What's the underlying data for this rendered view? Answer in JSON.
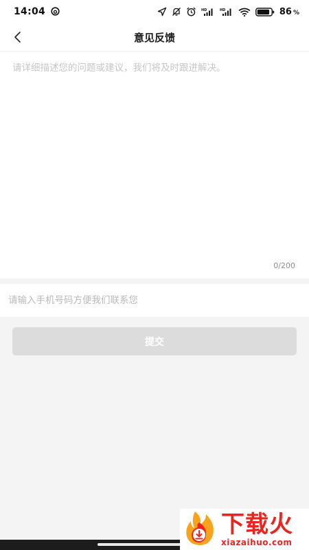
{
  "status_bar": {
    "time": "14:04",
    "battery_percent": "86",
    "percent_sign": "%",
    "icons": [
      "netease-cloud-icon",
      "location-arrow-icon",
      "mute-bell-icon",
      "alarm-icon",
      "signal-hd-1-icon",
      "signal-hd-2-icon",
      "wifi-icon",
      "battery-icon"
    ]
  },
  "nav": {
    "title": "意见反馈",
    "back_icon": "chevron-left-icon"
  },
  "feedback": {
    "placeholder": "请详细描述您的问题或建议，我们将及时跟进解决。",
    "value": "",
    "char_count": "0/200"
  },
  "phone": {
    "placeholder": "请输入手机号码方便我们联系您",
    "value": ""
  },
  "submit": {
    "label": "提交"
  },
  "watermark": {
    "cn": "下载火",
    "en": "xiazaihuo.com"
  },
  "colors": {
    "background": "#f4f4f4",
    "button_disabled": "#dcdcdc",
    "watermark_red": "#e8261d",
    "watermark_orange": "#f7a31b"
  }
}
